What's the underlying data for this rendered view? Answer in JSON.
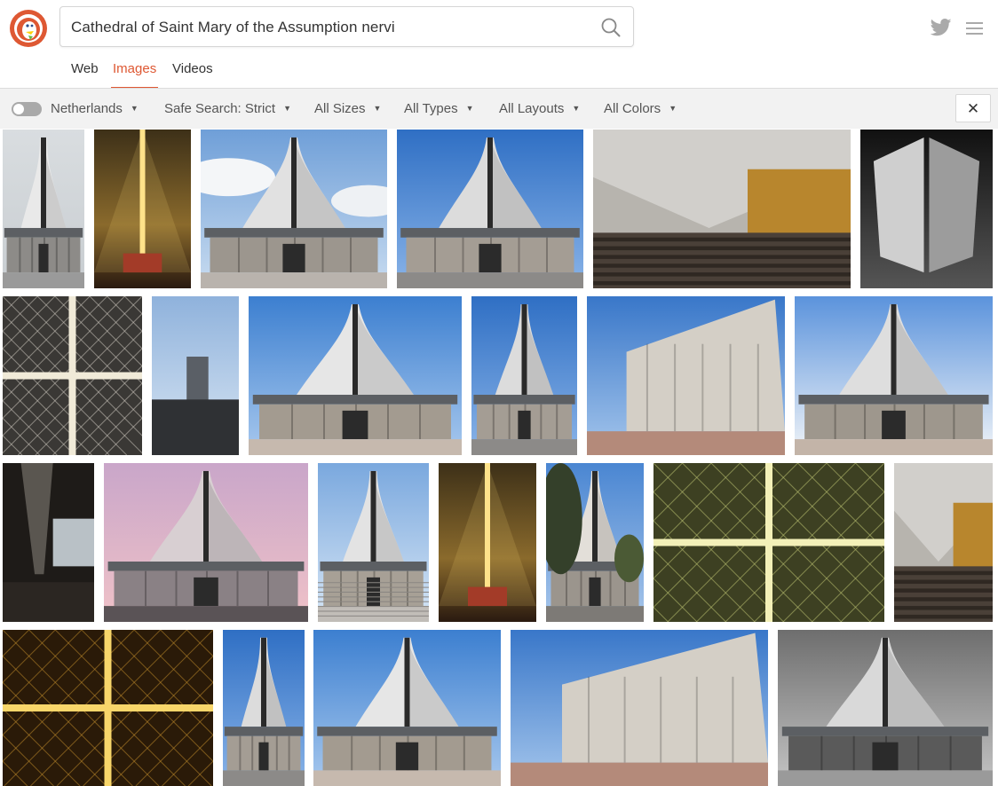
{
  "search": {
    "query": "Cathedral of Saint Mary of the Assumption nervi"
  },
  "nav": {
    "tabs": [
      "Web",
      "Images",
      "Videos"
    ],
    "active": "Images"
  },
  "filters": {
    "region_toggle": false,
    "items": [
      "Netherlands",
      "Safe Search: Strict",
      "All Sizes",
      "All Types",
      "All Layouts",
      "All Colors"
    ]
  },
  "icons": {
    "logo": "duckduckgo-logo",
    "search": "search-icon",
    "twitter": "twitter-icon",
    "menu": "hamburger-menu-icon",
    "close": "close-icon",
    "caret": "caret-down-icon"
  },
  "colors": {
    "accent": "#de5833",
    "filterbar": "#f2f2f2"
  },
  "results": [
    {
      "kind": "facade-sky"
    },
    {
      "kind": "interior-warm"
    },
    {
      "kind": "facade-clouds"
    },
    {
      "kind": "facade-blue"
    },
    {
      "kind": "interior-pews"
    },
    {
      "kind": "mono-dark"
    },
    {
      "kind": "ceiling-gray"
    },
    {
      "kind": "silhouette"
    },
    {
      "kind": "facade-clear"
    },
    {
      "kind": "facade-blue"
    },
    {
      "kind": "side-view"
    },
    {
      "kind": "facade-bright"
    },
    {
      "kind": "interior-dark"
    },
    {
      "kind": "facade-sunset"
    },
    {
      "kind": "facade-steps"
    },
    {
      "kind": "interior-warm"
    },
    {
      "kind": "facade-trees"
    },
    {
      "kind": "ceiling-yellow"
    },
    {
      "kind": "interior-pews"
    },
    {
      "kind": "ceiling-gold"
    },
    {
      "kind": "facade-blue"
    },
    {
      "kind": "facade-clear"
    },
    {
      "kind": "side-view"
    },
    {
      "kind": "mono-gray"
    }
  ]
}
